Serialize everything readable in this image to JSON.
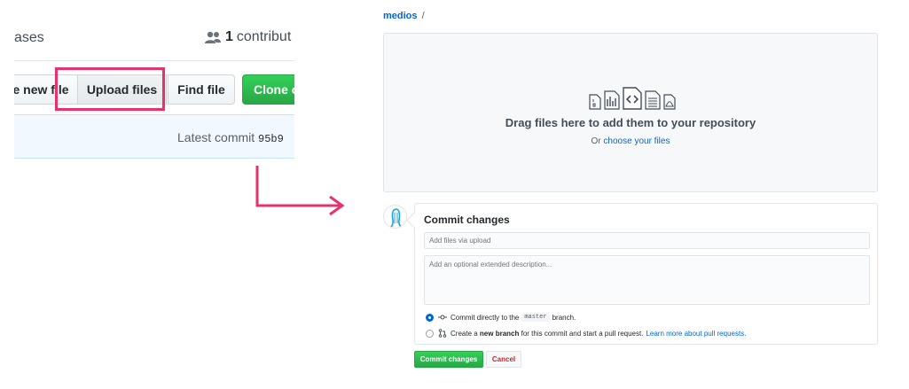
{
  "left_crop": {
    "releases_text": "ases",
    "contributors_count": "1",
    "contributors_label": "contribut",
    "buttons": {
      "create_new_file": "e new file",
      "upload_files": "Upload files",
      "find_file": "Find file",
      "clone": "Clone o"
    },
    "latest_commit_label": "Latest commit",
    "latest_commit_sha": "95b9"
  },
  "right_panel": {
    "breadcrumb_repo": "medios",
    "breadcrumb_sep": "/",
    "dropzone": {
      "title": "Drag files here to add them to your repository",
      "or_text": "Or",
      "choose_link": "choose your files"
    },
    "commit": {
      "title": "Commit changes",
      "summary_placeholder": "Add files via upload",
      "description_placeholder": "Add an optional extended description...",
      "option_direct_prefix": "Commit directly to the",
      "branch_name": "master",
      "option_direct_suffix": "branch.",
      "option_new_prefix": "Create a",
      "option_new_bold": "new branch",
      "option_new_suffix": "for this commit and start a pull request.",
      "learn_more_link": "Learn more about pull requests.",
      "commit_button": "Commit changes",
      "cancel_button": "Cancel",
      "selected_option": "direct"
    }
  },
  "colors": {
    "highlight": "#e8326e",
    "arrow": "#e8326e",
    "link": "#0366d6",
    "primary_green": "#28a745",
    "danger": "#cb2431"
  }
}
